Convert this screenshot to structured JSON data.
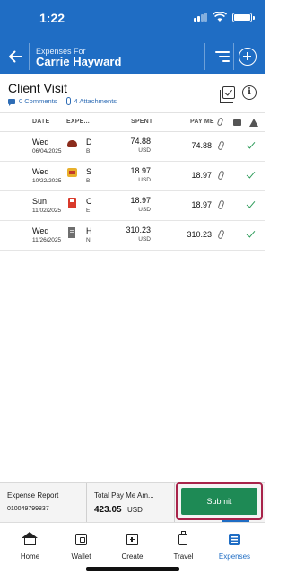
{
  "status_bar": {
    "time": "1:22"
  },
  "header": {
    "subtitle": "Expenses For",
    "title": "Carrie Hayward"
  },
  "report": {
    "title": "Client Visit",
    "comments": "0 Comments",
    "attachments": "4 Attachments"
  },
  "table": {
    "columns": {
      "date": "DATE",
      "expense": "EXPE...",
      "spent": "SPENT",
      "pay_me": "PAY ME"
    },
    "rows": [
      {
        "day": "Wed",
        "date": "06/04/2025",
        "icon": "dining-icon",
        "category": "D",
        "sub": "B.",
        "spent": "74.88",
        "currency": "USD",
        "pay_me": "74.88"
      },
      {
        "day": "Wed",
        "date": "10/22/2025",
        "icon": "fastfood-icon",
        "category": "S",
        "sub": "B.",
        "spent": "18.97",
        "currency": "USD",
        "pay_me": "18.97"
      },
      {
        "day": "Sun",
        "date": "11/02/2025",
        "icon": "fuel-icon",
        "category": "C",
        "sub": "E.",
        "spent": "18.97",
        "currency": "USD",
        "pay_me": "18.97"
      },
      {
        "day": "Wed",
        "date": "11/26/2025",
        "icon": "hotel-icon",
        "category": "H",
        "sub": "N.",
        "spent": "310.23",
        "currency": "USD",
        "pay_me": "310.23"
      }
    ]
  },
  "footer": {
    "report_label": "Expense Report",
    "report_id": "010049799837",
    "total_label": "Total Pay Me Am...",
    "total_amount": "423.05",
    "total_currency": "USD",
    "submit_label": "Submit"
  },
  "tabs": [
    {
      "label": "Home",
      "icon": "home-icon"
    },
    {
      "label": "Wallet",
      "icon": "wallet-icon"
    },
    {
      "label": "Create",
      "icon": "create-icon"
    },
    {
      "label": "Travel",
      "icon": "travel-icon"
    },
    {
      "label": "Expenses",
      "icon": "expenses-icon",
      "active": true
    }
  ],
  "colors": {
    "brand": "#1f6dc4",
    "submit": "#1e8a55",
    "highlight": "#a8234a",
    "check": "#2e9c5a"
  }
}
